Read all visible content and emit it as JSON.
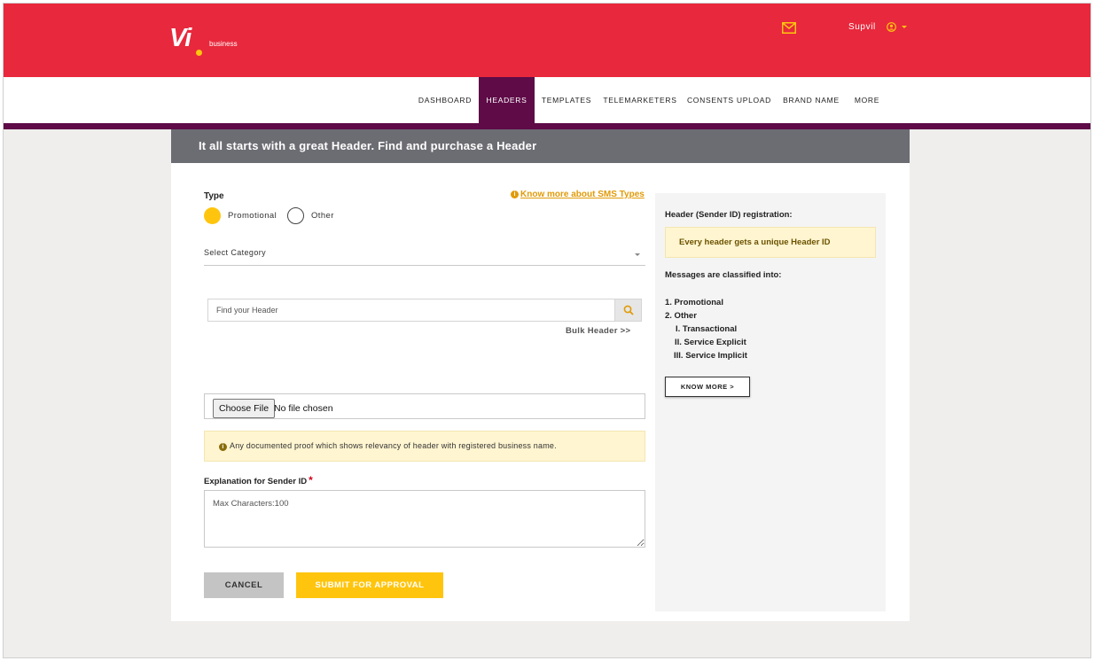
{
  "brand": {
    "logo_text": "Vi",
    "logo_sub": "business"
  },
  "topbar": {
    "user_name": "Supvil"
  },
  "nav": {
    "items": [
      {
        "label": "DASHBOARD",
        "active": false
      },
      {
        "label": "HEADERS",
        "active": true
      },
      {
        "label": "TEMPLATES",
        "active": false
      },
      {
        "label": "TELEMARKETERS",
        "active": false
      },
      {
        "label": "CONSENTS UPLOAD",
        "active": false
      },
      {
        "label": "BRAND NAME",
        "active": false
      },
      {
        "label": "MORE",
        "active": false
      }
    ]
  },
  "card": {
    "title": "It all starts with a great Header. Find and purchase a Header"
  },
  "form": {
    "type_label": "Type",
    "know_more_sms": "Know more about SMS Types",
    "radio_promotional": "Promotional",
    "radio_other": "Other",
    "selected_type": "Promotional",
    "select_category": "Select Category",
    "search_placeholder": "Find your Header",
    "bulk_header": "Bulk Header >>",
    "file_button": "Choose File",
    "file_status": "No file chosen",
    "proof_note": "Any documented proof which shows relevancy of header with registered business name.",
    "explanation_label": "Explanation for Sender ID",
    "required_mark": "*",
    "explanation_placeholder": "Max Characters:100",
    "cancel_label": "CANCEL",
    "submit_label": "SUBMIT FOR APPROVAL"
  },
  "side": {
    "title": "Header (Sender ID) registration:",
    "note": "Every header gets a unique Header ID",
    "classified": "Messages are classified into:",
    "list": [
      {
        "text": "1. Promotional"
      },
      {
        "text": "2. Other"
      },
      {
        "text": "I. Transactional"
      },
      {
        "text": "II. Service Explicit"
      },
      {
        "text": "III. Service Implicit"
      }
    ],
    "know_more": "KNOW MORE >"
  },
  "colors": {
    "brand_red": "#e8283c",
    "nav_active": "#5e0b47",
    "accent_yellow": "#ffc50e",
    "header_gray": "#6c6c73",
    "link_orange": "#e19a08"
  },
  "icons": [
    "mail-icon",
    "user-circle-icon",
    "chevron-down-icon",
    "search-icon",
    "info-icon"
  ]
}
